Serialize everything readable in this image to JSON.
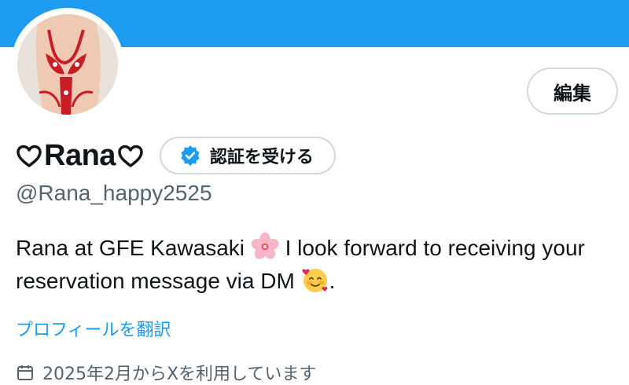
{
  "profile": {
    "display_name": "Rana",
    "handle": "@Rana_happy2525",
    "bio_part1": "Rana at GFE Kawasaki ",
    "bio_part2": " I look forward to receiving your reservation message via DM ",
    "bio_part3": ".",
    "translate_label": "プロフィールを翻訳",
    "joined_label": "2025年2月からXを利用しています"
  },
  "actions": {
    "edit_label": "編集",
    "verify_label": "認証を受ける"
  },
  "icons": {
    "name_prefix": "heart-outline-icon",
    "name_suffix": "heart-outline-icon",
    "verify": "verified-badge-icon",
    "bio_emoji_1": "cherry-blossom-icon",
    "bio_emoji_2": "smiling-face-with-hearts-icon",
    "joined": "calendar-icon"
  },
  "colors": {
    "banner": "#1d9bf0",
    "link": "#1d9bf0",
    "secondary_text": "#536471",
    "border": "#cfd9de"
  }
}
